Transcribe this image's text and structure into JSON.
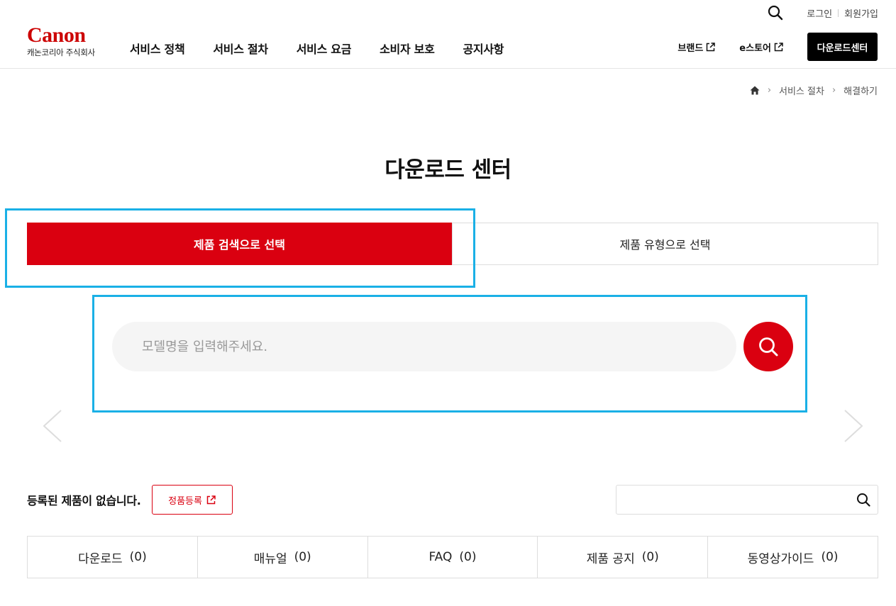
{
  "header": {
    "brand": "Canon",
    "corp_name": "캐논코리아 주식회사",
    "util": {
      "login": "로그인",
      "signup": "회원가입"
    },
    "gnb": [
      "서비스 정책",
      "서비스 절차",
      "서비스 요금",
      "소비자 보호",
      "공지사항"
    ],
    "right_nav": {
      "brand_link": "브랜드",
      "store_link": "e스토어",
      "download_center": "다운로드센터"
    }
  },
  "breadcrumb": {
    "items": [
      "서비스 절차",
      "해결하기"
    ]
  },
  "page_title": "다운로드 센터",
  "tabs": {
    "by_search": "제품 검색으로 선택",
    "by_type": "제품 유형으로 선택",
    "active": "by_search"
  },
  "search": {
    "placeholder": "모델명을 입력해주세요.",
    "value": ""
  },
  "registered": {
    "message": "등록된 제품이 없습니다.",
    "register_button": "정품등록"
  },
  "mini_search": {
    "placeholder": "",
    "value": ""
  },
  "categories": [
    {
      "label": "다운로드",
      "count": "(0)"
    },
    {
      "label": "매뉴얼",
      "count": "(0)"
    },
    {
      "label": "FAQ",
      "count": "(0)"
    },
    {
      "label": "제품 공지",
      "count": "(0)"
    },
    {
      "label": "동영상가이드",
      "count": "(0)"
    }
  ],
  "colors": {
    "accent": "#da0010",
    "highlight": "#1ab0e6",
    "brand_red": "#cc0000"
  }
}
